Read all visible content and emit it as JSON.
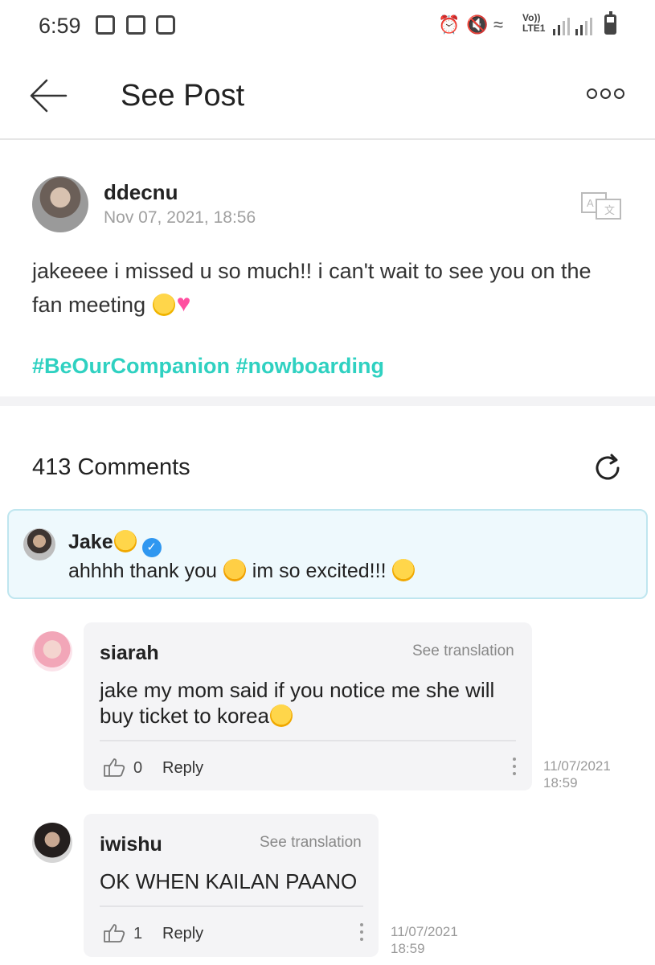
{
  "status_bar": {
    "time": "6:59",
    "network": "Vo))\nLTE1"
  },
  "app_bar": {
    "title": "See Post"
  },
  "post": {
    "author": "ddecnu",
    "timestamp": "Nov 07, 2021, 18:56",
    "body": "jakeeee i missed u so much!! i can't wait to see you on the fan meeting",
    "hashtags": "#BeOurCompanion #nowboarding"
  },
  "comments": {
    "count_label": "413 Comments",
    "pinned": {
      "name": "Jake",
      "text": "ahhhh thank you",
      "text_tail": "im so excited!!!"
    },
    "items": [
      {
        "name": "siarah",
        "translate_label": "See translation",
        "text": "jake my mom said if you notice me she will buy ticket to korea",
        "likes": "0",
        "reply_label": "Reply",
        "date": "11/07/2021",
        "time": "18:59"
      },
      {
        "name": "iwishu",
        "translate_label": "See translation",
        "text": "OK WHEN KAILAN PAANO",
        "likes": "1",
        "reply_label": "Reply",
        "date": "11/07/2021",
        "time": "18:59"
      }
    ]
  },
  "colors": {
    "hashtag": "#2fd1c1",
    "pinned_bg": "#eef9fd",
    "verified": "#2f97f0"
  }
}
